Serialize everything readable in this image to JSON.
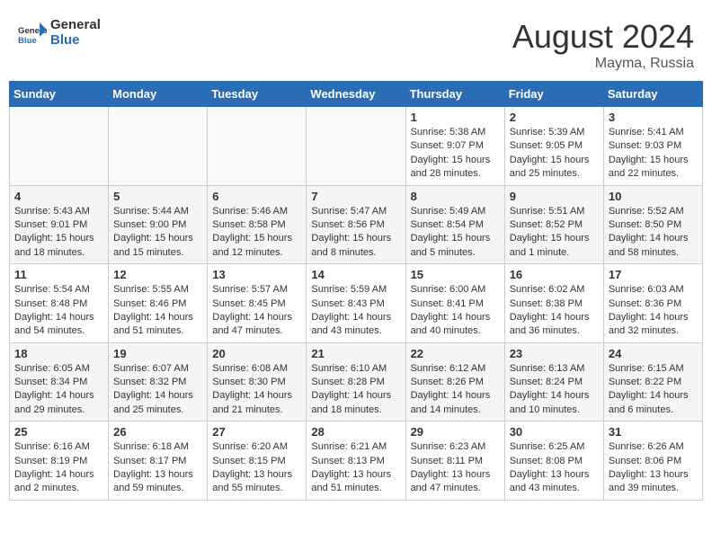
{
  "header": {
    "logo_general": "General",
    "logo_blue": "Blue",
    "month_year": "August 2024",
    "location": "Mayma, Russia"
  },
  "days_of_week": [
    "Sunday",
    "Monday",
    "Tuesday",
    "Wednesday",
    "Thursday",
    "Friday",
    "Saturday"
  ],
  "weeks": [
    [
      {
        "day": "",
        "info": ""
      },
      {
        "day": "",
        "info": ""
      },
      {
        "day": "",
        "info": ""
      },
      {
        "day": "",
        "info": ""
      },
      {
        "day": "1",
        "info": "Sunrise: 5:38 AM\nSunset: 9:07 PM\nDaylight: 15 hours\nand 28 minutes."
      },
      {
        "day": "2",
        "info": "Sunrise: 5:39 AM\nSunset: 9:05 PM\nDaylight: 15 hours\nand 25 minutes."
      },
      {
        "day": "3",
        "info": "Sunrise: 5:41 AM\nSunset: 9:03 PM\nDaylight: 15 hours\nand 22 minutes."
      }
    ],
    [
      {
        "day": "4",
        "info": "Sunrise: 5:43 AM\nSunset: 9:01 PM\nDaylight: 15 hours\nand 18 minutes."
      },
      {
        "day": "5",
        "info": "Sunrise: 5:44 AM\nSunset: 9:00 PM\nDaylight: 15 hours\nand 15 minutes."
      },
      {
        "day": "6",
        "info": "Sunrise: 5:46 AM\nSunset: 8:58 PM\nDaylight: 15 hours\nand 12 minutes."
      },
      {
        "day": "7",
        "info": "Sunrise: 5:47 AM\nSunset: 8:56 PM\nDaylight: 15 hours\nand 8 minutes."
      },
      {
        "day": "8",
        "info": "Sunrise: 5:49 AM\nSunset: 8:54 PM\nDaylight: 15 hours\nand 5 minutes."
      },
      {
        "day": "9",
        "info": "Sunrise: 5:51 AM\nSunset: 8:52 PM\nDaylight: 15 hours\nand 1 minute."
      },
      {
        "day": "10",
        "info": "Sunrise: 5:52 AM\nSunset: 8:50 PM\nDaylight: 14 hours\nand 58 minutes."
      }
    ],
    [
      {
        "day": "11",
        "info": "Sunrise: 5:54 AM\nSunset: 8:48 PM\nDaylight: 14 hours\nand 54 minutes."
      },
      {
        "day": "12",
        "info": "Sunrise: 5:55 AM\nSunset: 8:46 PM\nDaylight: 14 hours\nand 51 minutes."
      },
      {
        "day": "13",
        "info": "Sunrise: 5:57 AM\nSunset: 8:45 PM\nDaylight: 14 hours\nand 47 minutes."
      },
      {
        "day": "14",
        "info": "Sunrise: 5:59 AM\nSunset: 8:43 PM\nDaylight: 14 hours\nand 43 minutes."
      },
      {
        "day": "15",
        "info": "Sunrise: 6:00 AM\nSunset: 8:41 PM\nDaylight: 14 hours\nand 40 minutes."
      },
      {
        "day": "16",
        "info": "Sunrise: 6:02 AM\nSunset: 8:38 PM\nDaylight: 14 hours\nand 36 minutes."
      },
      {
        "day": "17",
        "info": "Sunrise: 6:03 AM\nSunset: 8:36 PM\nDaylight: 14 hours\nand 32 minutes."
      }
    ],
    [
      {
        "day": "18",
        "info": "Sunrise: 6:05 AM\nSunset: 8:34 PM\nDaylight: 14 hours\nand 29 minutes."
      },
      {
        "day": "19",
        "info": "Sunrise: 6:07 AM\nSunset: 8:32 PM\nDaylight: 14 hours\nand 25 minutes."
      },
      {
        "day": "20",
        "info": "Sunrise: 6:08 AM\nSunset: 8:30 PM\nDaylight: 14 hours\nand 21 minutes."
      },
      {
        "day": "21",
        "info": "Sunrise: 6:10 AM\nSunset: 8:28 PM\nDaylight: 14 hours\nand 18 minutes."
      },
      {
        "day": "22",
        "info": "Sunrise: 6:12 AM\nSunset: 8:26 PM\nDaylight: 14 hours\nand 14 minutes."
      },
      {
        "day": "23",
        "info": "Sunrise: 6:13 AM\nSunset: 8:24 PM\nDaylight: 14 hours\nand 10 minutes."
      },
      {
        "day": "24",
        "info": "Sunrise: 6:15 AM\nSunset: 8:22 PM\nDaylight: 14 hours\nand 6 minutes."
      }
    ],
    [
      {
        "day": "25",
        "info": "Sunrise: 6:16 AM\nSunset: 8:19 PM\nDaylight: 14 hours\nand 2 minutes."
      },
      {
        "day": "26",
        "info": "Sunrise: 6:18 AM\nSunset: 8:17 PM\nDaylight: 13 hours\nand 59 minutes."
      },
      {
        "day": "27",
        "info": "Sunrise: 6:20 AM\nSunset: 8:15 PM\nDaylight: 13 hours\nand 55 minutes."
      },
      {
        "day": "28",
        "info": "Sunrise: 6:21 AM\nSunset: 8:13 PM\nDaylight: 13 hours\nand 51 minutes."
      },
      {
        "day": "29",
        "info": "Sunrise: 6:23 AM\nSunset: 8:11 PM\nDaylight: 13 hours\nand 47 minutes."
      },
      {
        "day": "30",
        "info": "Sunrise: 6:25 AM\nSunset: 8:08 PM\nDaylight: 13 hours\nand 43 minutes."
      },
      {
        "day": "31",
        "info": "Sunrise: 6:26 AM\nSunset: 8:06 PM\nDaylight: 13 hours\nand 39 minutes."
      }
    ]
  ]
}
